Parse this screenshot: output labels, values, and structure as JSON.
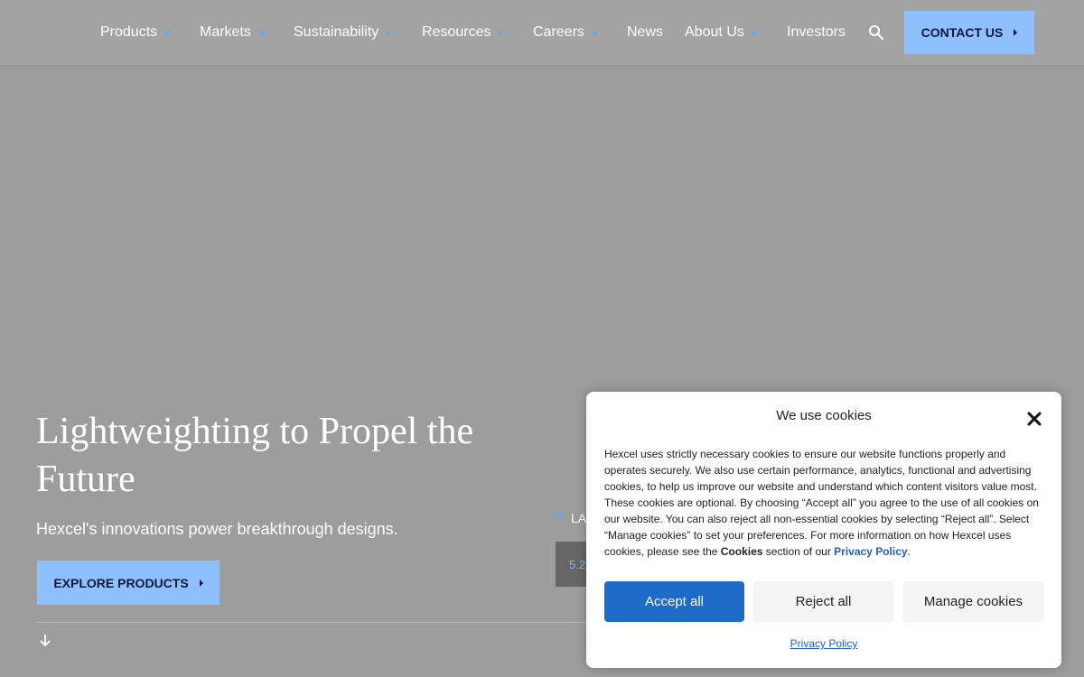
{
  "nav": {
    "items": [
      {
        "label": "Products",
        "has_caret": true
      },
      {
        "label": "Markets",
        "has_caret": true
      },
      {
        "label": "Sustainability",
        "has_caret": true
      },
      {
        "label": "Resources",
        "has_caret": true
      },
      {
        "label": "Careers",
        "has_caret": true
      },
      {
        "label": "News",
        "has_caret": false
      },
      {
        "label": "About Us",
        "has_caret": true
      },
      {
        "label": "Investors",
        "has_caret": false
      }
    ],
    "search_icon": "search-icon",
    "contact_label": "CONTACT US"
  },
  "hero": {
    "title": "Lightweighting to Propel the Future",
    "subtitle": "Hexcel's innovations power breakthrough designs.",
    "cta_label": "EXPLORE PRODUCTS",
    "scroll_icon": "arrow-down-icon"
  },
  "latest": {
    "label": "LA",
    "date": "5.2"
  },
  "cookie": {
    "title": "We use cookies",
    "body_main": "Hexcel uses strictly necessary cookies to ensure our website functions properly and operates securely. We also use certain performance, analytics, functional and advertising cookies, to help us improve our website and understand which content visitors value most. These cookies are optional. By choosing “Accept all” you agree to the use of all cookies on our website. You can also reject all non-essential cookies by selecting “Reject all”. Select “Manage cookies” to set your preferences. For more information on how Hexcel uses cookies, please see the ",
    "body_cookies_word": "Cookies",
    "body_mid": " section of our ",
    "body_privacy_link": "Privacy Policy",
    "body_end": ".",
    "accept_label": "Accept all",
    "reject_label": "Reject all",
    "manage_label": "Manage cookies",
    "privacy_link": "Privacy Policy"
  },
  "colors": {
    "background": "#9d9d9d",
    "accent_button": "#8ebfff",
    "accept_button": "#1e6cc8",
    "link": "#1e5fbf",
    "caret": "#5aa9ff"
  }
}
